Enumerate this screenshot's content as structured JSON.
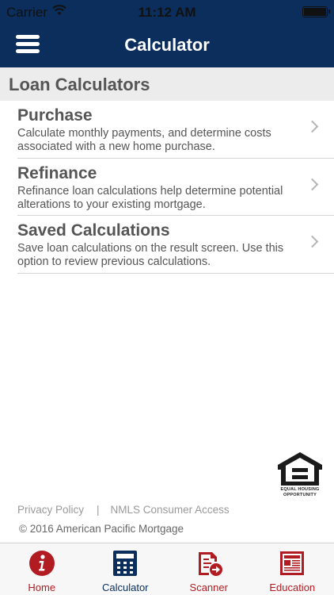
{
  "status_bar": {
    "carrier": "Carrier",
    "time": "11:12 AM"
  },
  "nav": {
    "title": "Calculator"
  },
  "section": {
    "title": "Loan Calculators"
  },
  "items": [
    {
      "title": "Purchase",
      "description": "Calculate monthly payments, and determine costs associated with a new home purchase."
    },
    {
      "title": "Refinance",
      "description": "Refinance loan calculations help determine potential alterations to your existing mortgage."
    },
    {
      "title": "Saved Calculations",
      "description": "Save loan calculations on the result screen. Use this option to review previous calculations."
    }
  ],
  "badge": {
    "line1": "EQUAL HOUSING",
    "line2": "OPPORTUNITY"
  },
  "footer": {
    "privacy": "Privacy Policy",
    "separator": "|",
    "nmls": "NMLS Consumer Access",
    "copyright": "© 2016 American Pacific Mortgage"
  },
  "tabs": {
    "home": "Home",
    "calculator": "Calculator",
    "scanner": "Scanner",
    "education": "Education"
  },
  "colors": {
    "brand_navy": "#0b2e5c",
    "brand_red": "#b01c22"
  }
}
